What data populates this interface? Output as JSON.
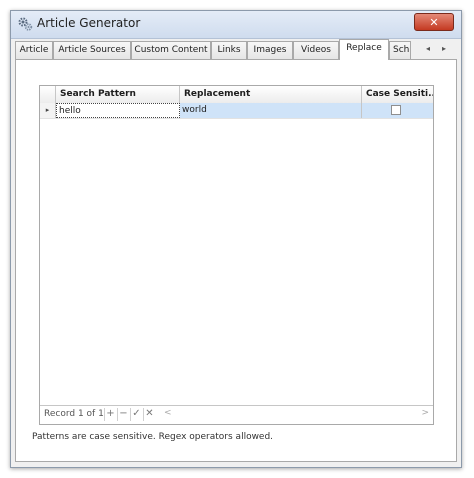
{
  "window": {
    "title": "Article Generator",
    "close_glyph": "✕"
  },
  "tabs": [
    {
      "label": "Article"
    },
    {
      "label": "Article Sources"
    },
    {
      "label": "Custom Content"
    },
    {
      "label": "Links"
    },
    {
      "label": "Images"
    },
    {
      "label": "Videos"
    },
    {
      "label": "Replace",
      "active": true
    },
    {
      "label": "Sch"
    }
  ],
  "tab_scroll": {
    "left": "◂",
    "right": "▸"
  },
  "grid": {
    "columns": [
      "Search Pattern",
      "Replacement",
      "Case Sensiti..."
    ],
    "rows": [
      {
        "indicator": "▸",
        "search_pattern": "hello",
        "replacement": "world",
        "case_sensitive": false
      }
    ]
  },
  "navigator": {
    "record_text": "Record 1 of 1",
    "add": "+",
    "remove": "−",
    "confirm": "✓",
    "cancel": "✕",
    "scroll_left": "<",
    "scroll_right": ">"
  },
  "hint_text": "Patterns are case sensitive. Regex operators allowed.",
  "colors": {
    "selection": "#cfe3f8",
    "close_button": "#c43a22"
  }
}
